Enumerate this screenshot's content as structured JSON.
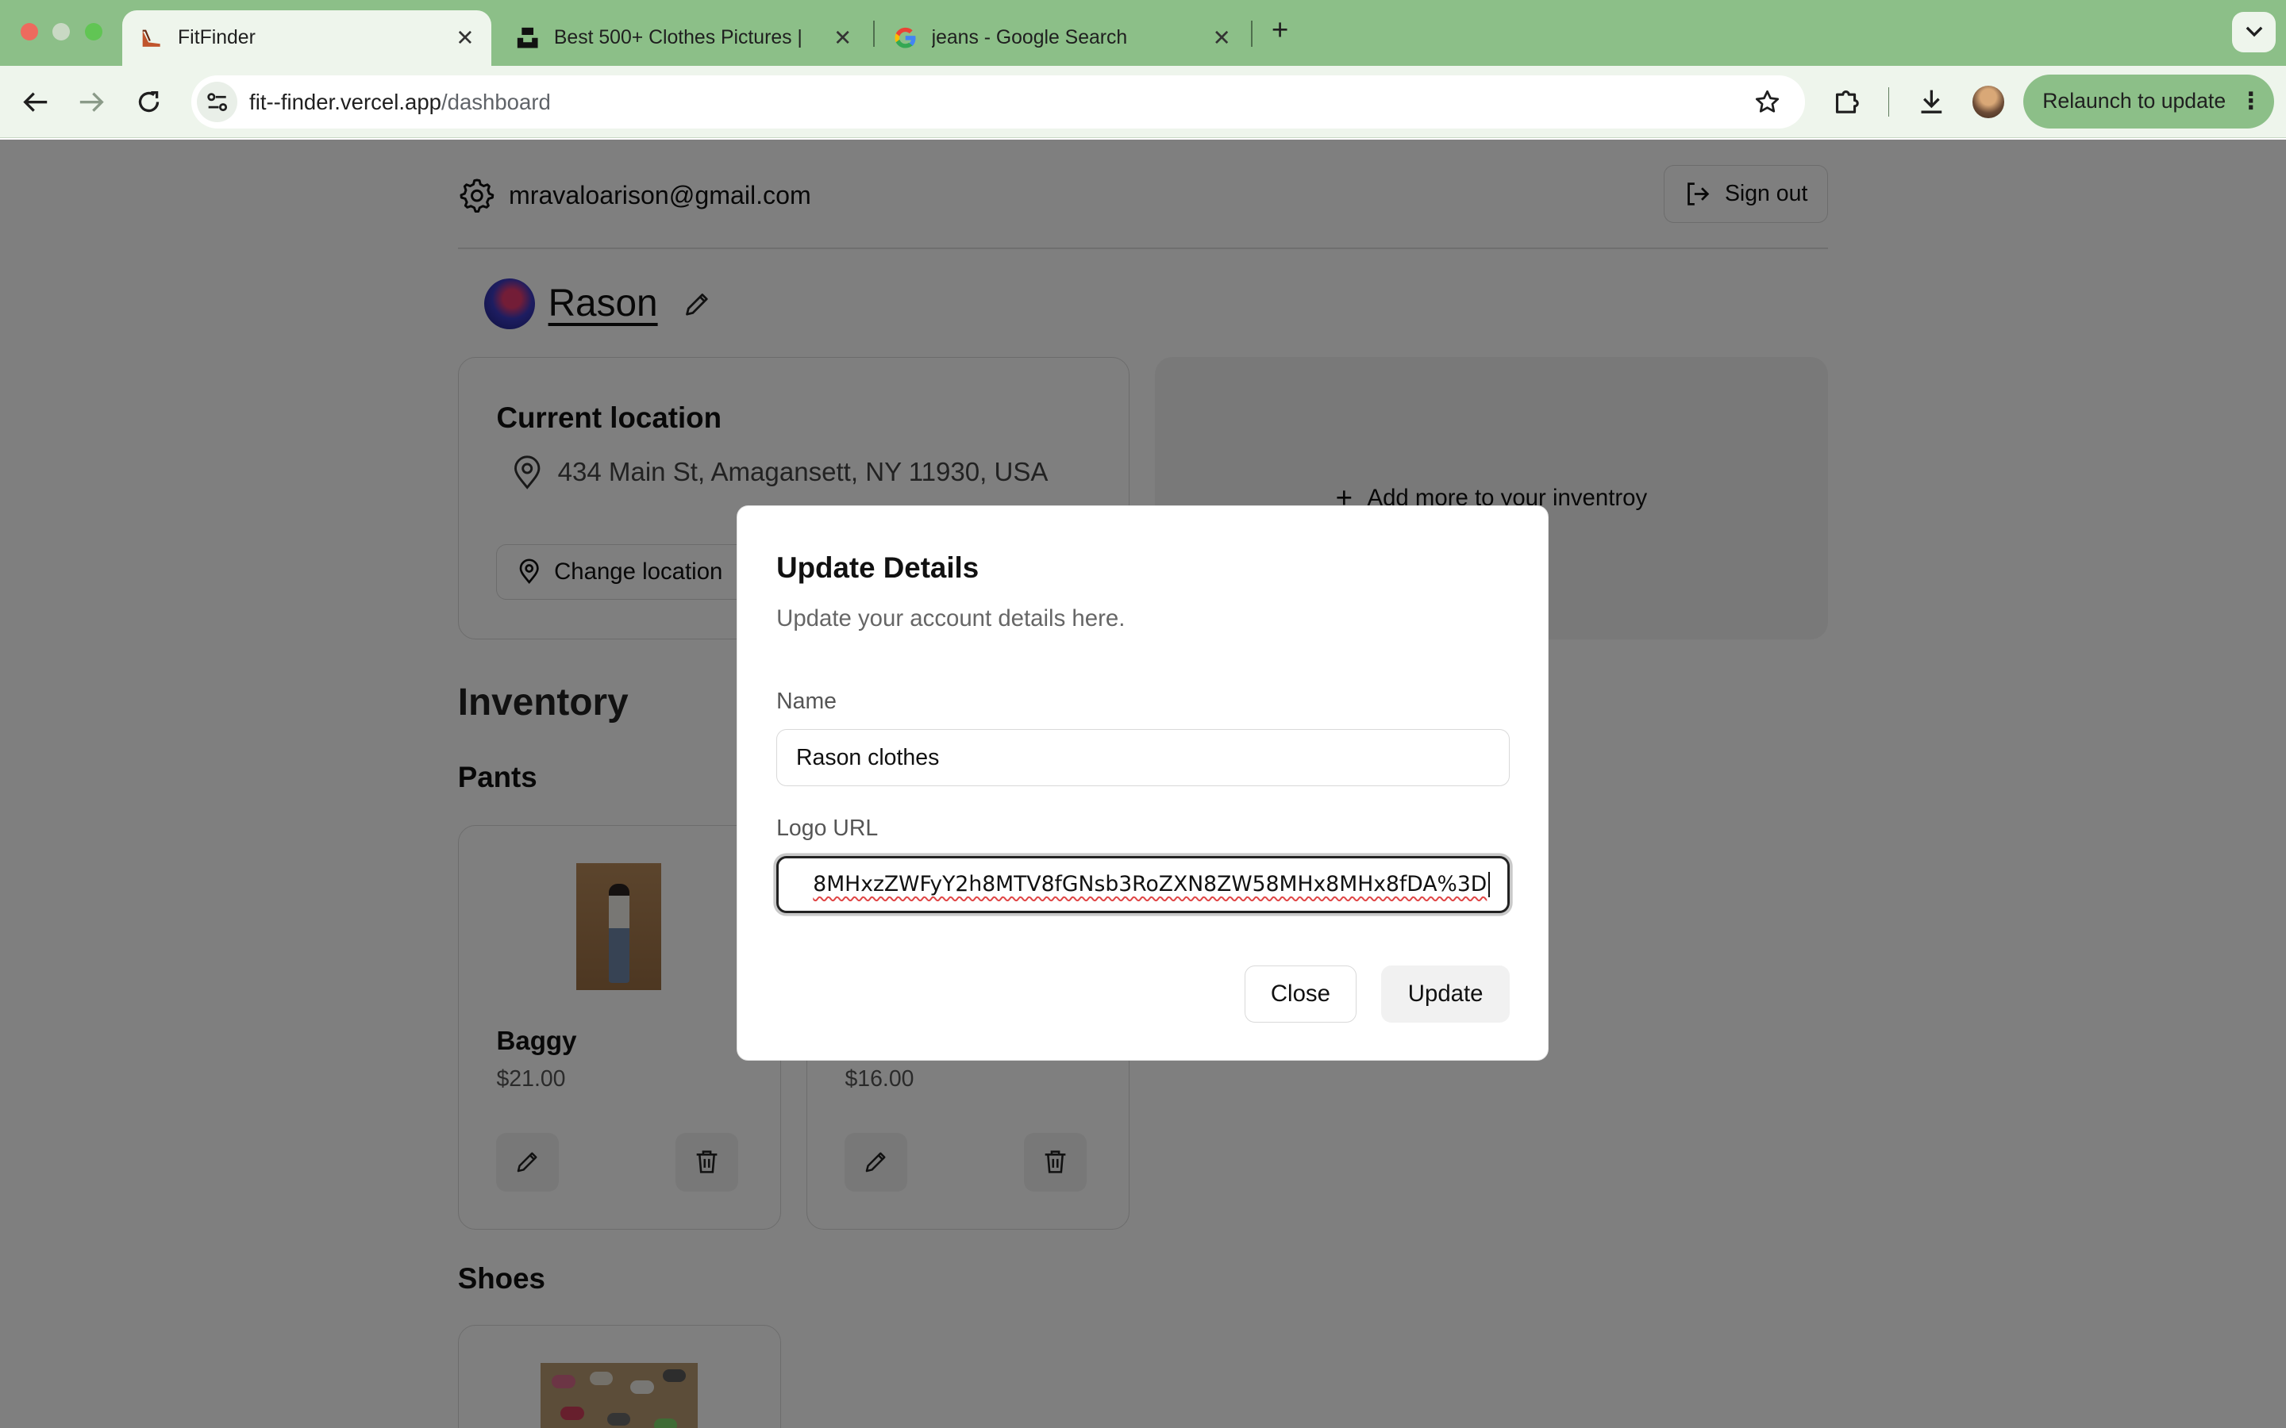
{
  "browser": {
    "tabs": [
      {
        "title": "FitFinder",
        "active": true,
        "icon": "fitfinder-favicon"
      },
      {
        "title": "Best 500+ Clothes Pictures | ",
        "active": false,
        "icon": "unsplash-favicon"
      },
      {
        "title": "jeans - Google Search",
        "active": false,
        "icon": "google-favicon"
      }
    ],
    "url_host": "fit--finder.vercel.app",
    "url_path": "/dashboard",
    "relaunch_label": "Relaunch to update",
    "colors": {
      "frame": "#8cbf88",
      "toolbar": "#eef5ec"
    }
  },
  "header": {
    "email": "mravaloarison@gmail.com",
    "signout_label": "Sign out"
  },
  "brand": {
    "name": "Rason"
  },
  "location": {
    "title": "Current location",
    "address": "434 Main St, Amagansett, NY 11930, USA",
    "change_label": "Change location"
  },
  "inventory": {
    "add_label": "Add more to your inventroy",
    "title": "Inventory",
    "categories": [
      {
        "name": "Pants",
        "items": [
          {
            "name": "Baggy",
            "price": "$21.00"
          },
          {
            "name": "",
            "price": "$16.00"
          }
        ]
      },
      {
        "name": "Shoes",
        "items": []
      }
    ]
  },
  "modal": {
    "title": "Update Details",
    "subtitle": "Update your account details here.",
    "name_label": "Name",
    "name_value": "Rason clothes",
    "logo_label": "Logo URL",
    "logo_value": "8MHxzZWFyY2h8MTV8fGNsb3RoZXN8ZW58MHx8MHx8fDA%3D",
    "close_label": "Close",
    "update_label": "Update"
  }
}
